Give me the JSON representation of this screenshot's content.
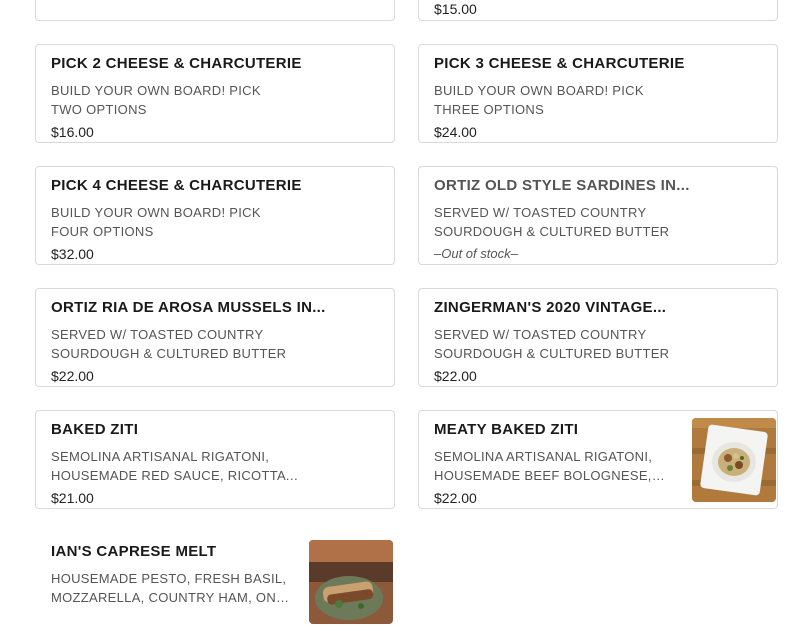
{
  "items": [
    {
      "title": "",
      "description": "",
      "price": ""
    },
    {
      "title": "",
      "description": "",
      "price": "$15.00"
    },
    {
      "title": "PICK 2 CHEESE & CHARCUTERIE",
      "description": "BUILD YOUR OWN BOARD! PICK TWO OPTIONS",
      "price": "$16.00"
    },
    {
      "title": "PICK 3 CHEESE & CHARCUTERIE",
      "description": "BUILD YOUR OWN BOARD! PICK THREE OPTIONS",
      "price": "$24.00"
    },
    {
      "title": "PICK 4 CHEESE & CHARCUTERIE",
      "description": "BUILD YOUR OWN BOARD! PICK FOUR OPTIONS",
      "price": "$32.00"
    },
    {
      "title": "ORTIZ OLD STYLE SARDINES IN...",
      "description": "SERVED W/ TOASTED COUNTRY SOURDOUGH & CULTURED BUTTER",
      "status": "–Out of stock–"
    },
    {
      "title": "ORTIZ RIA DE AROSA MUSSELS IN...",
      "description": "SERVED W/ TOASTED COUNTRY SOURDOUGH & CULTURED BUTTER",
      "price": "$22.00"
    },
    {
      "title": "ZINGERMAN'S 2020 VINTAGE...",
      "description": "SERVED W/ TOASTED COUNTRY SOURDOUGH & CULTURED BUTTER",
      "price": "$22.00"
    },
    {
      "title": "BAKED ZITI",
      "description": "SEMOLINA ARTISANAL RIGATONI, HOUSEMADE RED SAUCE, RICOTTA CHEES...",
      "price": "$21.00"
    },
    {
      "title": "MEATY BAKED ZITI",
      "description": "SEMOLINA ARTISANAL RIGATONI, HOUSEMADE BEEF BOLOGNESE, RICOTTA...",
      "price": "$22.00",
      "image": "baked-ziti-photo"
    },
    {
      "title": "IAN'S CAPRESE MELT",
      "description": "HOUSEMADE PESTO, FRESH BASIL, MOZZARELLA, COUNTRY HAM, ON CLARK...",
      "image": "caprese-melt-photo"
    }
  ]
}
